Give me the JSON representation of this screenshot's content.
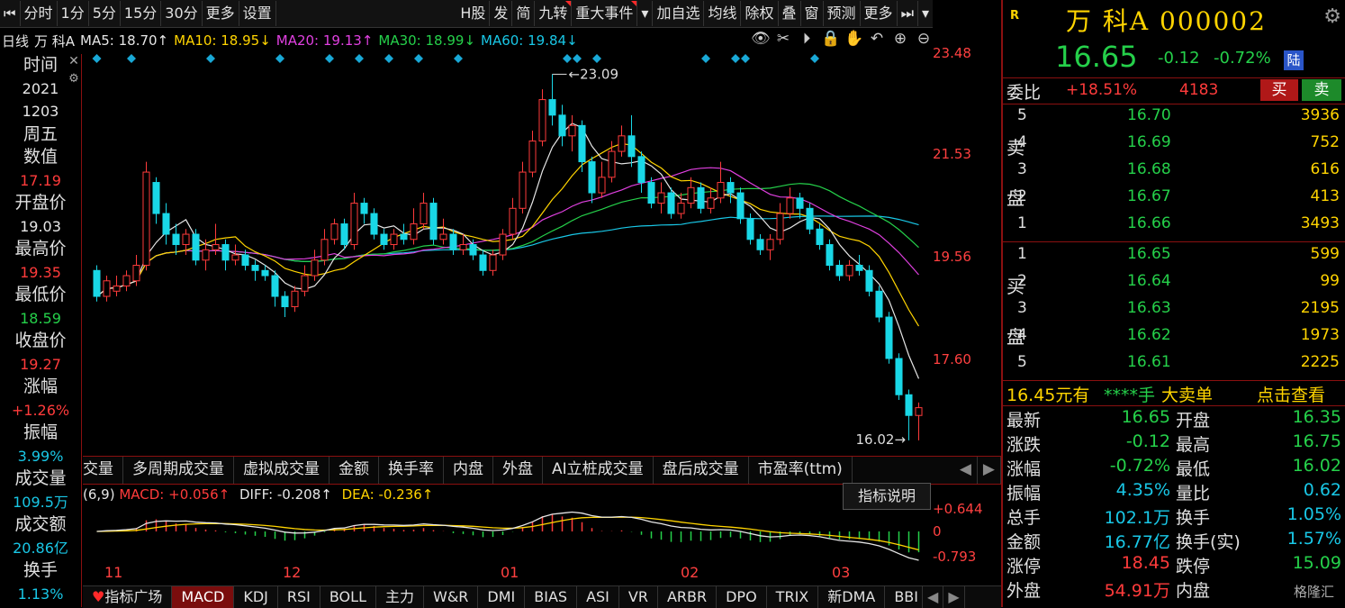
{
  "toolbar": {
    "items": [
      "分时",
      "1分",
      "5分",
      "15分",
      "30分",
      "更多",
      "设置",
      "H股",
      "发",
      "简",
      "九转",
      "重大事件",
      "加自选",
      "均线",
      "除权",
      "叠",
      "窗",
      "预测",
      "更多"
    ]
  },
  "ma_bar": {
    "period": "日线",
    "stock": "万 科A",
    "ma5": "MA5: 18.70↑",
    "ma10": "MA10: 18.95↓",
    "ma20": "MA20: 19.13↑",
    "ma30": "MA30: 18.99↓",
    "ma60": "MA60: 19.84↓"
  },
  "left_info": {
    "time_label": "时间",
    "year": "2021",
    "date": "1203",
    "weekday": "周五",
    "value_label": "数值",
    "value": "17.19",
    "open_label": "开盘价",
    "open": "19.03",
    "high_label": "最高价",
    "high": "19.35",
    "low_label": "最低价",
    "low": "18.59",
    "close_label": "收盘价",
    "close": "19.27",
    "chg_label": "涨幅",
    "chg": "+1.26%",
    "amp_label": "振幅",
    "amp": "3.99%",
    "vol_label": "成交量",
    "vol": "109.5万",
    "amt_label": "成交额",
    "amt": "20.86亿",
    "turn_label": "换手",
    "turn": "1.13%"
  },
  "chart_data": {
    "type": "candlestick",
    "y_ticks": [
      "23.48",
      "21.53",
      "19.56",
      "17.60"
    ],
    "high_annotation": "23.09",
    "low_annotation": "16.02",
    "x_labels": [
      "11",
      "12",
      "01",
      "02",
      "03"
    ],
    "candles": [
      [
        19.3,
        18.8,
        19.4,
        18.7
      ],
      [
        18.8,
        19.1,
        19.2,
        18.7
      ],
      [
        18.9,
        19.0,
        19.2,
        18.8
      ],
      [
        19.0,
        19.2,
        19.3,
        18.9
      ],
      [
        19.1,
        19.4,
        19.6,
        19.0
      ],
      [
        19.4,
        21.2,
        21.4,
        19.3
      ],
      [
        21.0,
        20.4,
        21.1,
        20.2
      ],
      [
        20.4,
        20.0,
        20.6,
        19.8
      ],
      [
        20.0,
        19.8,
        20.2,
        19.6
      ],
      [
        19.8,
        20.0,
        20.1,
        19.6
      ],
      [
        20.0,
        19.5,
        20.1,
        19.4
      ],
      [
        19.5,
        19.7,
        19.9,
        19.3
      ],
      [
        19.7,
        19.8,
        20.2,
        19.6
      ],
      [
        19.8,
        19.5,
        19.9,
        19.3
      ],
      [
        19.5,
        19.6,
        19.8,
        19.4
      ],
      [
        19.6,
        19.4,
        19.7,
        19.3
      ],
      [
        19.4,
        19.3,
        19.5,
        19.1
      ],
      [
        19.3,
        19.2,
        19.4,
        19.1
      ],
      [
        19.2,
        18.8,
        19.3,
        18.6
      ],
      [
        18.8,
        18.6,
        18.9,
        18.4
      ],
      [
        18.6,
        18.9,
        19.0,
        18.5
      ],
      [
        18.9,
        19.2,
        19.4,
        18.8
      ],
      [
        19.2,
        19.5,
        19.7,
        19.1
      ],
      [
        19.5,
        19.9,
        20.1,
        19.4
      ],
      [
        19.9,
        20.2,
        20.3,
        19.8
      ],
      [
        20.2,
        19.8,
        20.3,
        19.7
      ],
      [
        19.8,
        20.6,
        20.8,
        19.7
      ],
      [
        20.6,
        20.4,
        20.7,
        20.2
      ],
      [
        20.4,
        20.0,
        20.5,
        19.9
      ],
      [
        20.0,
        19.8,
        20.1,
        19.7
      ],
      [
        19.8,
        20.0,
        20.1,
        19.7
      ],
      [
        20.0,
        19.9,
        20.2,
        19.8
      ],
      [
        19.9,
        20.2,
        20.5,
        19.8
      ],
      [
        20.2,
        20.6,
        20.8,
        20.1
      ],
      [
        20.6,
        19.9,
        20.7,
        19.8
      ],
      [
        19.9,
        20.0,
        20.3,
        19.8
      ],
      [
        20.0,
        19.7,
        20.1,
        19.6
      ],
      [
        19.7,
        19.8,
        20.0,
        19.6
      ],
      [
        19.8,
        19.6,
        19.9,
        19.5
      ],
      [
        19.6,
        19.3,
        19.7,
        19.2
      ],
      [
        19.3,
        19.6,
        19.7,
        19.2
      ],
      [
        19.6,
        20.0,
        20.1,
        19.5
      ],
      [
        20.0,
        20.5,
        20.7,
        19.9
      ],
      [
        20.5,
        21.2,
        21.4,
        20.4
      ],
      [
        21.2,
        21.8,
        22.0,
        21.1
      ],
      [
        21.8,
        22.6,
        22.8,
        21.7
      ],
      [
        22.6,
        22.3,
        23.09,
        22.1
      ],
      [
        22.3,
        21.9,
        22.5,
        21.7
      ],
      [
        21.9,
        22.1,
        22.3,
        21.6
      ],
      [
        22.1,
        21.4,
        22.2,
        21.2
      ],
      [
        21.4,
        20.8,
        21.5,
        20.6
      ],
      [
        20.8,
        21.1,
        21.4,
        20.7
      ],
      [
        21.1,
        21.6,
        21.8,
        21.0
      ],
      [
        21.6,
        21.9,
        22.1,
        21.5
      ],
      [
        21.9,
        21.5,
        22.3,
        21.3
      ],
      [
        21.5,
        21.0,
        21.6,
        20.8
      ],
      [
        21.0,
        20.6,
        21.1,
        20.5
      ],
      [
        20.6,
        20.8,
        21.0,
        20.4
      ],
      [
        20.8,
        20.4,
        20.9,
        20.3
      ],
      [
        20.4,
        20.6,
        20.8,
        20.3
      ],
      [
        20.6,
        20.9,
        21.1,
        20.5
      ],
      [
        20.9,
        20.5,
        21.0,
        20.4
      ],
      [
        20.5,
        20.7,
        20.9,
        20.4
      ],
      [
        20.7,
        21.0,
        21.4,
        20.6
      ],
      [
        21.0,
        20.8,
        21.1,
        20.6
      ],
      [
        20.8,
        20.3,
        20.9,
        20.2
      ],
      [
        20.3,
        19.9,
        20.4,
        19.8
      ],
      [
        19.9,
        19.7,
        20.0,
        19.6
      ],
      [
        19.7,
        19.9,
        20.0,
        19.5
      ],
      [
        19.9,
        20.4,
        20.6,
        19.8
      ],
      [
        20.4,
        20.7,
        20.9,
        20.3
      ],
      [
        20.7,
        20.5,
        20.8,
        20.3
      ],
      [
        20.5,
        20.1,
        20.6,
        20.0
      ],
      [
        20.1,
        19.8,
        20.2,
        19.7
      ],
      [
        19.8,
        19.4,
        19.9,
        19.3
      ],
      [
        19.4,
        19.2,
        19.5,
        19.1
      ],
      [
        19.2,
        19.4,
        19.5,
        19.1
      ],
      [
        19.4,
        19.3,
        19.6,
        19.2
      ],
      [
        19.3,
        18.9,
        19.4,
        18.8
      ],
      [
        18.9,
        18.4,
        19.0,
        18.3
      ],
      [
        18.4,
        17.6,
        18.5,
        17.5
      ],
      [
        17.6,
        16.9,
        17.7,
        16.8
      ],
      [
        16.9,
        16.5,
        17.0,
        16.02
      ],
      [
        16.5,
        16.65,
        16.75,
        16.02
      ]
    ]
  },
  "indicator_tabs": [
    "交量",
    "多周期成交量",
    "虚拟成交量",
    "金额",
    "换手率",
    "内盘",
    "外盘",
    "AI立桩成交量",
    "盘后成交量",
    "市盈率(ttm)"
  ],
  "macd": {
    "params": "(6,9)",
    "macd": "MACD: +0.056↑",
    "diff": "DIFF: -0.208↑",
    "dea": "DEA: -0.236↑",
    "explain": "指标说明",
    "axis": [
      "+0.644",
      "0",
      "-0.793"
    ]
  },
  "bottom_tabs": [
    "指标广场",
    "MACD",
    "KDJ",
    "RSI",
    "BOLL",
    "主力",
    "W&R",
    "DMI",
    "BIAS",
    "ASI",
    "VR",
    "ARBR",
    "DPO",
    "TRIX",
    "新DMA",
    "BBI"
  ],
  "right": {
    "badge": "R",
    "name": "万 科A 000002",
    "price": "16.65",
    "change": "-0.12",
    "pct": "-0.72%",
    "market_tag": "陆",
    "wb_label": "委比",
    "wb_value": "+18.51%",
    "wb_diff": "4183",
    "buy_btn": "买",
    "sell_btn": "卖",
    "sell_label": [
      "卖",
      "盘"
    ],
    "buy_label": [
      "买",
      "盘"
    ],
    "asks": [
      [
        "5",
        "16.70",
        "3936"
      ],
      [
        "4",
        "16.69",
        "752"
      ],
      [
        "3",
        "16.68",
        "616"
      ],
      [
        "2",
        "16.67",
        "413"
      ],
      [
        "1",
        "16.66",
        "3493"
      ]
    ],
    "bids": [
      [
        "1",
        "16.65",
        "599"
      ],
      [
        "2",
        "16.64",
        "99"
      ],
      [
        "3",
        "16.63",
        "2195"
      ],
      [
        "4",
        "16.62",
        "1973"
      ],
      [
        "5",
        "16.61",
        "2225"
      ]
    ],
    "bigorder_price": "16.45元有",
    "bigorder_qty": "****手",
    "bigorder_type": "大卖单",
    "bigorder_link": "点击查看",
    "stats": [
      [
        "最新",
        "16.65",
        "开盘",
        "16.35"
      ],
      [
        "涨跌",
        "-0.12",
        "最高",
        "16.75"
      ],
      [
        "涨幅",
        "-0.72%",
        "最低",
        "16.02"
      ],
      [
        "振幅",
        "4.35%",
        "量比",
        "0.62"
      ],
      [
        "总手",
        "102.1万",
        "换手",
        "1.05%"
      ],
      [
        "金额",
        "16.77亿",
        "换手(实)",
        "1.57%"
      ],
      [
        "涨停",
        "18.45",
        "跌停",
        "15.09"
      ],
      [
        "外盘",
        "54.91万",
        "内盘",
        ""
      ]
    ],
    "watermark": "格隆汇"
  }
}
